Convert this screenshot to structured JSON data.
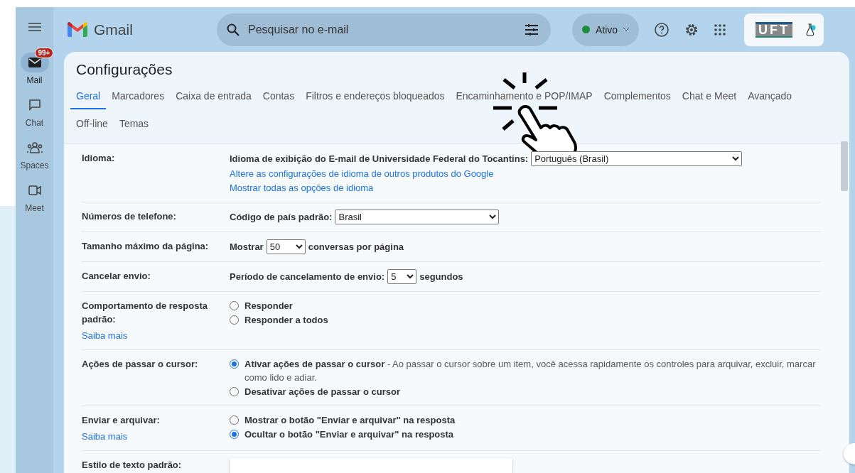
{
  "rail": {
    "items": [
      {
        "kind": "mail",
        "label": "Mail",
        "selected": true,
        "badge": "99+"
      },
      {
        "kind": "chat",
        "label": "Chat",
        "selected": false
      },
      {
        "kind": "spaces",
        "label": "Spaces",
        "selected": false
      },
      {
        "kind": "meet",
        "label": "Meet",
        "selected": false
      }
    ]
  },
  "header": {
    "app_name": "Gmail",
    "search": {
      "placeholder": "Pesquisar no e-mail"
    },
    "status": {
      "label": "Ativo",
      "color": "#1e8e3e"
    },
    "org_logo": {
      "text": "UFT"
    }
  },
  "settings": {
    "title": "Configurações",
    "tab_rows": [
      [
        {
          "label": "Geral",
          "selected": true
        },
        {
          "label": "Marcadores",
          "selected": false
        },
        {
          "label": "Caixa de entrada",
          "selected": false
        },
        {
          "label": "Contas",
          "selected": false
        },
        {
          "label": "Filtros e endereços bloqueados",
          "selected": false
        },
        {
          "label": "Encaminhamento e POP/IMAP",
          "selected": false
        },
        {
          "label": "Complementos",
          "selected": false
        },
        {
          "label": "Chat e Meet",
          "selected": false
        },
        {
          "label": "Avançado",
          "selected": false
        }
      ],
      [
        {
          "label": "Off-line",
          "selected": false
        },
        {
          "label": "Temas",
          "selected": false
        }
      ]
    ],
    "rows": [
      {
        "label": "Idioma:",
        "items": [
          {
            "kind": "select",
            "prefix": "Idioma de exibição do E-mail de Universidade Federal do Tocantins:",
            "value": "Português (Brasil)"
          },
          {
            "kind": "link",
            "text": "Altere as configurações de idioma de outros produtos do Google"
          },
          {
            "kind": "link",
            "text": "Mostrar todas as opções de idioma"
          }
        ]
      },
      {
        "label": "Números de telefone:",
        "items": [
          {
            "kind": "select",
            "prefix": "Código de país padrão:",
            "value": "Brasil"
          }
        ]
      },
      {
        "label": "Tamanho máximo da página:",
        "items": [
          {
            "kind": "select",
            "prefix": "Mostrar",
            "value": "50",
            "suffix": "conversas por página"
          }
        ]
      },
      {
        "label": "Cancelar envio:",
        "items": [
          {
            "kind": "select",
            "prefix": "Período de cancelamento de envio:",
            "value": "5",
            "suffix": "segundos"
          }
        ]
      },
      {
        "label": "Comportamento de resposta padrão:",
        "link": "Saiba mais",
        "items": [
          {
            "kind": "radio",
            "label": "Responder",
            "selected": false
          },
          {
            "kind": "radio",
            "label": "Responder a todos",
            "selected": false
          }
        ]
      },
      {
        "label": "Ações de passar o cursor:",
        "items": [
          {
            "kind": "radio",
            "label": "Ativar ações de passar o cursor",
            "description": "- Ao passar o cursor sobre um item, você acessa rapidamente os controles para arquivar, excluir, marcar como lido e adiar.",
            "selected": true
          },
          {
            "kind": "radio",
            "label": "Desativar ações de passar o cursor",
            "selected": false
          }
        ]
      },
      {
        "label": "Enviar e arquivar:",
        "link": "Saiba mais",
        "items": [
          {
            "kind": "radio",
            "label": "Mostrar o botão \"Enviar e arquivar\" na resposta",
            "selected": false
          },
          {
            "kind": "radio",
            "label": "Ocultar o botão \"Enviar e arquivar\" na resposta",
            "selected": true
          }
        ]
      },
      {
        "label": "Estilo de texto padrão:",
        "items": [
          {
            "kind": "toolbar"
          }
        ]
      }
    ]
  }
}
